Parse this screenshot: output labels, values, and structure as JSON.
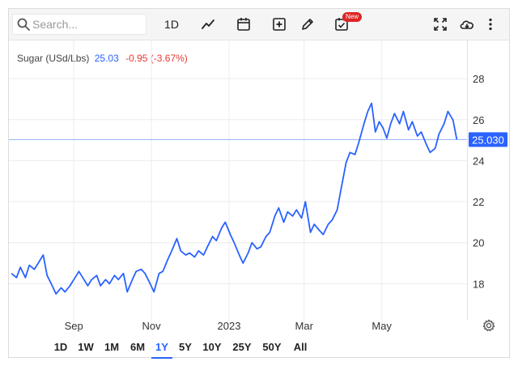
{
  "toolbar": {
    "search_placeholder": "Search...",
    "interval_label": "1D",
    "new_badge": "New"
  },
  "legend": {
    "symbol": "Sugar (USd/Lbs)",
    "last": "25.03",
    "change": "-0.95 (-3.67%)"
  },
  "colors": {
    "line": "#2962ff",
    "negative": "#e53935",
    "grid": "#ececec",
    "price_tag": "#2962ff"
  },
  "range_buttons": {
    "items": [
      {
        "label": "1D"
      },
      {
        "label": "1W"
      },
      {
        "label": "1M"
      },
      {
        "label": "6M"
      },
      {
        "label": "1Y",
        "active": true
      },
      {
        "label": "5Y"
      },
      {
        "label": "10Y"
      },
      {
        "label": "25Y"
      },
      {
        "label": "50Y"
      },
      {
        "label": "All"
      }
    ]
  },
  "chart_data": {
    "type": "line",
    "title": "Sugar (USd/Lbs)",
    "xlabel": "",
    "ylabel": "",
    "x_ticks": [
      {
        "label": "Sep",
        "x": "2022-09-01"
      },
      {
        "label": "Nov",
        "x": "2022-11-01"
      },
      {
        "label": "2023",
        "x": "2023-01-01"
      },
      {
        "label": "Mar",
        "x": "2023-03-01"
      },
      {
        "label": "May",
        "x": "2023-05-01"
      }
    ],
    "y_ticks": [
      18,
      20,
      22,
      24,
      26,
      28
    ],
    "ylim": [
      16,
      29.9
    ],
    "xlim": [
      "2022-07-12",
      "2023-07-07"
    ],
    "grid": true,
    "current_price": 25.03,
    "current_price_label": "25.030",
    "series": [
      {
        "values": [
          [
            "2022-07-14",
            18.5
          ],
          [
            "2022-07-18",
            18.3
          ],
          [
            "2022-07-21",
            18.8
          ],
          [
            "2022-07-25",
            18.3
          ],
          [
            "2022-07-28",
            18.9
          ],
          [
            "2022-08-01",
            18.7
          ],
          [
            "2022-08-04",
            19.0
          ],
          [
            "2022-08-08",
            19.4
          ],
          [
            "2022-08-11",
            18.4
          ],
          [
            "2022-08-15",
            17.9
          ],
          [
            "2022-08-18",
            17.5
          ],
          [
            "2022-08-22",
            17.8
          ],
          [
            "2022-08-25",
            17.6
          ],
          [
            "2022-08-29",
            17.9
          ],
          [
            "2022-09-01",
            18.2
          ],
          [
            "2022-09-05",
            18.6
          ],
          [
            "2022-09-08",
            18.3
          ],
          [
            "2022-09-12",
            17.9
          ],
          [
            "2022-09-15",
            18.2
          ],
          [
            "2022-09-19",
            18.4
          ],
          [
            "2022-09-22",
            17.9
          ],
          [
            "2022-09-26",
            18.2
          ],
          [
            "2022-09-29",
            18.0
          ],
          [
            "2022-10-03",
            18.4
          ],
          [
            "2022-10-06",
            18.2
          ],
          [
            "2022-10-10",
            18.5
          ],
          [
            "2022-10-13",
            17.6
          ],
          [
            "2022-10-17",
            18.2
          ],
          [
            "2022-10-20",
            18.6
          ],
          [
            "2022-10-24",
            18.7
          ],
          [
            "2022-10-27",
            18.5
          ],
          [
            "2022-10-31",
            18.0
          ],
          [
            "2022-11-03",
            17.6
          ],
          [
            "2022-11-07",
            18.5
          ],
          [
            "2022-11-10",
            18.6
          ],
          [
            "2022-11-14",
            19.2
          ],
          [
            "2022-11-17",
            19.6
          ],
          [
            "2022-11-21",
            20.2
          ],
          [
            "2022-11-24",
            19.6
          ],
          [
            "2022-11-28",
            19.4
          ],
          [
            "2022-12-01",
            19.5
          ],
          [
            "2022-12-05",
            19.3
          ],
          [
            "2022-12-08",
            19.6
          ],
          [
            "2022-12-12",
            19.4
          ],
          [
            "2022-12-15",
            19.8
          ],
          [
            "2022-12-19",
            20.3
          ],
          [
            "2022-12-22",
            20.1
          ],
          [
            "2022-12-26",
            20.7
          ],
          [
            "2022-12-29",
            21.0
          ],
          [
            "2023-01-02",
            20.4
          ],
          [
            "2023-01-05",
            20.0
          ],
          [
            "2023-01-09",
            19.4
          ],
          [
            "2023-01-12",
            19.0
          ],
          [
            "2023-01-16",
            19.5
          ],
          [
            "2023-01-19",
            20.0
          ],
          [
            "2023-01-23",
            19.7
          ],
          [
            "2023-01-26",
            19.8
          ],
          [
            "2023-01-30",
            20.3
          ],
          [
            "2023-02-02",
            20.5
          ],
          [
            "2023-02-06",
            21.3
          ],
          [
            "2023-02-09",
            21.7
          ],
          [
            "2023-02-13",
            21.0
          ],
          [
            "2023-02-16",
            21.5
          ],
          [
            "2023-02-20",
            21.3
          ],
          [
            "2023-02-23",
            21.6
          ],
          [
            "2023-02-27",
            21.2
          ],
          [
            "2023-03-02",
            22.0
          ],
          [
            "2023-03-06",
            20.5
          ],
          [
            "2023-03-09",
            20.9
          ],
          [
            "2023-03-13",
            20.6
          ],
          [
            "2023-03-16",
            20.4
          ],
          [
            "2023-03-20",
            20.9
          ],
          [
            "2023-03-23",
            21.1
          ],
          [
            "2023-03-27",
            21.6
          ],
          [
            "2023-03-30",
            22.6
          ],
          [
            "2023-04-03",
            23.9
          ],
          [
            "2023-04-06",
            24.4
          ],
          [
            "2023-04-10",
            24.3
          ],
          [
            "2023-04-13",
            24.9
          ],
          [
            "2023-04-17",
            25.8
          ],
          [
            "2023-04-20",
            26.4
          ],
          [
            "2023-04-23",
            26.8
          ],
          [
            "2023-04-26",
            25.4
          ],
          [
            "2023-04-29",
            25.9
          ],
          [
            "2023-05-02",
            25.6
          ],
          [
            "2023-05-05",
            25.1
          ],
          [
            "2023-05-08",
            25.8
          ],
          [
            "2023-05-11",
            26.3
          ],
          [
            "2023-05-15",
            25.8
          ],
          [
            "2023-05-18",
            26.4
          ],
          [
            "2023-05-22",
            25.5
          ],
          [
            "2023-05-25",
            25.9
          ],
          [
            "2023-05-29",
            25.2
          ],
          [
            "2023-06-01",
            25.4
          ],
          [
            "2023-06-05",
            24.8
          ],
          [
            "2023-06-08",
            24.4
          ],
          [
            "2023-06-12",
            24.6
          ],
          [
            "2023-06-15",
            25.3
          ],
          [
            "2023-06-19",
            25.8
          ],
          [
            "2023-06-22",
            26.4
          ],
          [
            "2023-06-26",
            25.98
          ],
          [
            "2023-06-29",
            25.03
          ]
        ]
      }
    ]
  }
}
